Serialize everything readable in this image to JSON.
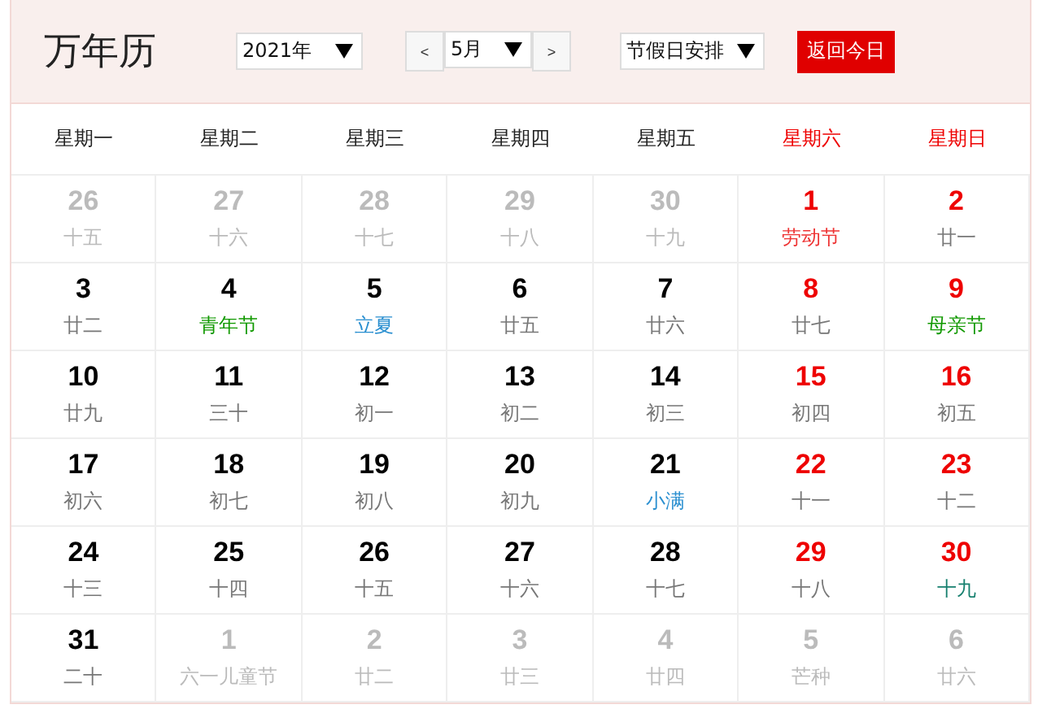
{
  "title": "万年历",
  "controls": {
    "year": "2021年",
    "prev": "<",
    "month": "5月",
    "next": ">",
    "holidays": "节假日安排",
    "today": "返回今日"
  },
  "weekdays": [
    {
      "label": "星期一",
      "weekend": false
    },
    {
      "label": "星期二",
      "weekend": false
    },
    {
      "label": "星期三",
      "weekend": false
    },
    {
      "label": "星期四",
      "weekend": false
    },
    {
      "label": "星期五",
      "weekend": false
    },
    {
      "label": "星期六",
      "weekend": true
    },
    {
      "label": "星期日",
      "weekend": true
    }
  ],
  "days": [
    {
      "day": "26",
      "note": "十五",
      "other_month": true,
      "weekend": false,
      "kind": "lunar"
    },
    {
      "day": "27",
      "note": "十六",
      "other_month": true,
      "weekend": false,
      "kind": "lunar"
    },
    {
      "day": "28",
      "note": "十七",
      "other_month": true,
      "weekend": false,
      "kind": "lunar"
    },
    {
      "day": "29",
      "note": "十八",
      "other_month": true,
      "weekend": false,
      "kind": "lunar"
    },
    {
      "day": "30",
      "note": "十九",
      "other_month": true,
      "weekend": false,
      "kind": "lunar"
    },
    {
      "day": "1",
      "note": "劳动节",
      "other_month": false,
      "weekend": true,
      "kind": "holiday"
    },
    {
      "day": "2",
      "note": "廿一",
      "other_month": false,
      "weekend": true,
      "kind": "lunar"
    },
    {
      "day": "3",
      "note": "廿二",
      "other_month": false,
      "weekend": false,
      "kind": "lunar"
    },
    {
      "day": "4",
      "note": "青年节",
      "other_month": false,
      "weekend": false,
      "kind": "festival"
    },
    {
      "day": "5",
      "note": "立夏",
      "other_month": false,
      "weekend": false,
      "kind": "solar_term"
    },
    {
      "day": "6",
      "note": "廿五",
      "other_month": false,
      "weekend": false,
      "kind": "lunar"
    },
    {
      "day": "7",
      "note": "廿六",
      "other_month": false,
      "weekend": false,
      "kind": "lunar"
    },
    {
      "day": "8",
      "note": "廿七",
      "other_month": false,
      "weekend": true,
      "kind": "lunar"
    },
    {
      "day": "9",
      "note": "母亲节",
      "other_month": false,
      "weekend": true,
      "kind": "festival"
    },
    {
      "day": "10",
      "note": "廿九",
      "other_month": false,
      "weekend": false,
      "kind": "lunar"
    },
    {
      "day": "11",
      "note": "三十",
      "other_month": false,
      "weekend": false,
      "kind": "lunar"
    },
    {
      "day": "12",
      "note": "初一",
      "other_month": false,
      "weekend": false,
      "kind": "lunar"
    },
    {
      "day": "13",
      "note": "初二",
      "other_month": false,
      "weekend": false,
      "kind": "lunar"
    },
    {
      "day": "14",
      "note": "初三",
      "other_month": false,
      "weekend": false,
      "kind": "lunar"
    },
    {
      "day": "15",
      "note": "初四",
      "other_month": false,
      "weekend": true,
      "kind": "lunar"
    },
    {
      "day": "16",
      "note": "初五",
      "other_month": false,
      "weekend": true,
      "kind": "lunar"
    },
    {
      "day": "17",
      "note": "初六",
      "other_month": false,
      "weekend": false,
      "kind": "lunar"
    },
    {
      "day": "18",
      "note": "初七",
      "other_month": false,
      "weekend": false,
      "kind": "lunar"
    },
    {
      "day": "19",
      "note": "初八",
      "other_month": false,
      "weekend": false,
      "kind": "lunar"
    },
    {
      "day": "20",
      "note": "初九",
      "other_month": false,
      "weekend": false,
      "kind": "lunar"
    },
    {
      "day": "21",
      "note": "小满",
      "other_month": false,
      "weekend": false,
      "kind": "solar_term"
    },
    {
      "day": "22",
      "note": "十一",
      "other_month": false,
      "weekend": true,
      "kind": "lunar"
    },
    {
      "day": "23",
      "note": "十二",
      "other_month": false,
      "weekend": true,
      "kind": "lunar"
    },
    {
      "day": "24",
      "note": "十三",
      "other_month": false,
      "weekend": false,
      "kind": "lunar"
    },
    {
      "day": "25",
      "note": "十四",
      "other_month": false,
      "weekend": false,
      "kind": "lunar"
    },
    {
      "day": "26",
      "note": "十五",
      "other_month": false,
      "weekend": false,
      "kind": "lunar"
    },
    {
      "day": "27",
      "note": "十六",
      "other_month": false,
      "weekend": false,
      "kind": "lunar"
    },
    {
      "day": "28",
      "note": "十七",
      "other_month": false,
      "weekend": false,
      "kind": "lunar"
    },
    {
      "day": "29",
      "note": "十八",
      "other_month": false,
      "weekend": true,
      "kind": "lunar"
    },
    {
      "day": "30",
      "note": "十九",
      "other_month": false,
      "weekend": true,
      "kind": "solar_term_lunar"
    },
    {
      "day": "31",
      "note": "二十",
      "other_month": false,
      "weekend": false,
      "kind": "lunar"
    },
    {
      "day": "1",
      "note": "六一儿童节",
      "other_month": true,
      "weekend": false,
      "kind": "festival"
    },
    {
      "day": "2",
      "note": "廿二",
      "other_month": true,
      "weekend": false,
      "kind": "lunar"
    },
    {
      "day": "3",
      "note": "廿三",
      "other_month": true,
      "weekend": false,
      "kind": "lunar"
    },
    {
      "day": "4",
      "note": "廿四",
      "other_month": true,
      "weekend": false,
      "kind": "lunar"
    },
    {
      "day": "5",
      "note": "芒种",
      "other_month": true,
      "weekend": false,
      "kind": "solar_term"
    },
    {
      "day": "6",
      "note": "廿六",
      "other_month": true,
      "weekend": false,
      "kind": "lunar"
    }
  ]
}
